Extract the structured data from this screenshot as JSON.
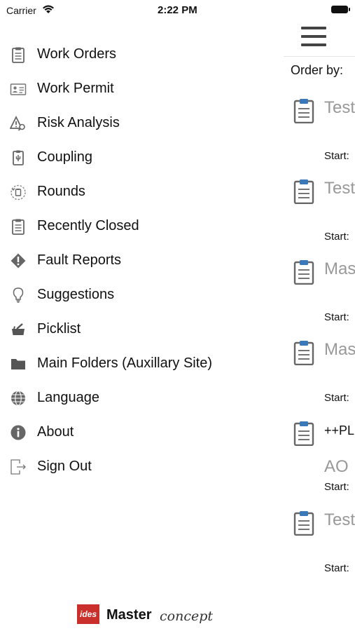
{
  "status_bar": {
    "carrier": "Carrier",
    "time": "2:22 PM"
  },
  "menu": {
    "items": [
      {
        "label": "Work Orders",
        "icon": "clipboard-icon"
      },
      {
        "label": "Work Permit",
        "icon": "id-card-icon"
      },
      {
        "label": "Risk Analysis",
        "icon": "warning-search-icon"
      },
      {
        "label": "Coupling",
        "icon": "coupling-icon"
      },
      {
        "label": "Rounds",
        "icon": "rounds-icon"
      },
      {
        "label": "Recently Closed",
        "icon": "clipboard-icon"
      },
      {
        "label": "Fault Reports",
        "icon": "diamond-alert-icon"
      },
      {
        "label": "Suggestions",
        "icon": "lightbulb-icon"
      },
      {
        "label": "Picklist",
        "icon": "picklist-icon"
      },
      {
        "label": "Main Folders (Auxillary Site)",
        "icon": "folder-icon"
      },
      {
        "label": "Language",
        "icon": "globe-icon"
      },
      {
        "label": "About",
        "icon": "info-icon"
      },
      {
        "label": "Sign Out",
        "icon": "sign-out-icon"
      }
    ]
  },
  "brand": {
    "ides": "ides",
    "master": "Master",
    "concept": "concept"
  },
  "panel": {
    "order_by": "Order by:",
    "rows": [
      {
        "title": "Test",
        "sub": "",
        "start": "Start:"
      },
      {
        "title": "Test",
        "sub": "",
        "start": "Start:"
      },
      {
        "title": "Mas",
        "sub": "",
        "start": "Start:"
      },
      {
        "title": "Mas",
        "sub": "",
        "start": "Start:"
      },
      {
        "title": "++PL",
        "sub": "AO",
        "start": "Start:"
      },
      {
        "title": "Test",
        "sub": "",
        "start": "Start:"
      }
    ]
  },
  "colors": {
    "clipboard_clip": "#3a78b8",
    "icon_gray": "#666666",
    "brand_red": "#c9302c"
  }
}
